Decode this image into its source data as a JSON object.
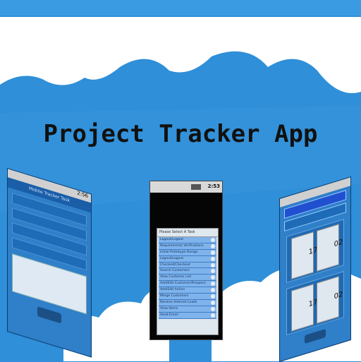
{
  "title": "Project Tracker App",
  "center_phone": {
    "time": "2:53",
    "list_header": "Please Select A Task",
    "items": [
      "Logout/Logout",
      "Requirements Verifications",
      "Initial Prototype Design",
      "Logout/Logout",
      "Checked/Checkout",
      "Search Customers",
      "View Customer List",
      "Add/Edit Customer/Prospect",
      "Add/Edit Action",
      "Merge Customers",
      "Receive Internet Leads",
      "View Items",
      "Send Email"
    ]
  },
  "left_phone": {
    "time": "2:56",
    "header": "Mobile Tracker Task"
  },
  "right_phone": {
    "picker_hour": "17",
    "picker_min": "02",
    "picker2_hour": "17",
    "picker2_min": "02"
  },
  "colors": {
    "sky": "#2f8fd8",
    "cloud": "#ffffff",
    "list_row": "#7fb3ec"
  }
}
